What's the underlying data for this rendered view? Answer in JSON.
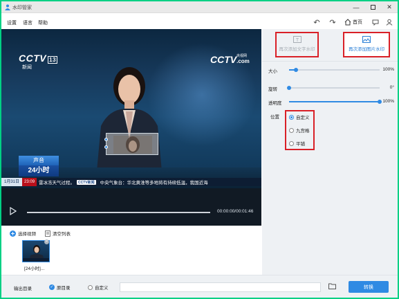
{
  "window": {
    "title": "水印管家"
  },
  "menu": {
    "items": [
      "设置",
      "语言",
      "帮助"
    ],
    "home_label": "首页"
  },
  "video": {
    "logo_left": "CCTV",
    "logo_left_channel": "13",
    "logo_left_sub": "新闻",
    "logo_right": "CCTV",
    "logo_right_suffix": ".com",
    "logo_right_sub": "央视网",
    "lower_third_top": "声音",
    "lower_third_bottom": "24小时",
    "ticker_date": "1月31日",
    "ticker_time": "23:09",
    "ticker_text_1": "雷冰冻天气过程。",
    "ticker_logo": "CCTV新闻",
    "ticker_text_2": "中央气象台：华北黄淮等多地将有持续低温，我国近海",
    "time_display": "00:00:00/00:01:46",
    "progress": 0
  },
  "panel": {
    "tab_text_label": "再次添加文字水印",
    "tab_image_label": "再次添加图片水印",
    "sliders": [
      {
        "label": "大小",
        "value_text": "100%",
        "fraction": 0.08
      },
      {
        "label": "旋转",
        "value_text": "0°",
        "fraction": 0.0
      },
      {
        "label": "透明度",
        "value_text": "100%",
        "fraction": 1.0
      }
    ],
    "position_label": "位置",
    "position_options": [
      "自定义",
      "九宫格",
      "平铺"
    ],
    "position_selected": "自定义"
  },
  "files": {
    "select_label": "选择视频",
    "clear_label": "清空列表",
    "items": [
      {
        "name": "[24小时]..."
      }
    ]
  },
  "bottom": {
    "output_label": "输出目录",
    "option_original": "原目录",
    "option_custom": "自定义",
    "path_value": "",
    "convert_label": "转换"
  },
  "colors": {
    "accent": "#2f8ae3",
    "highlight": "#d91f26",
    "frame": "#00d084"
  }
}
